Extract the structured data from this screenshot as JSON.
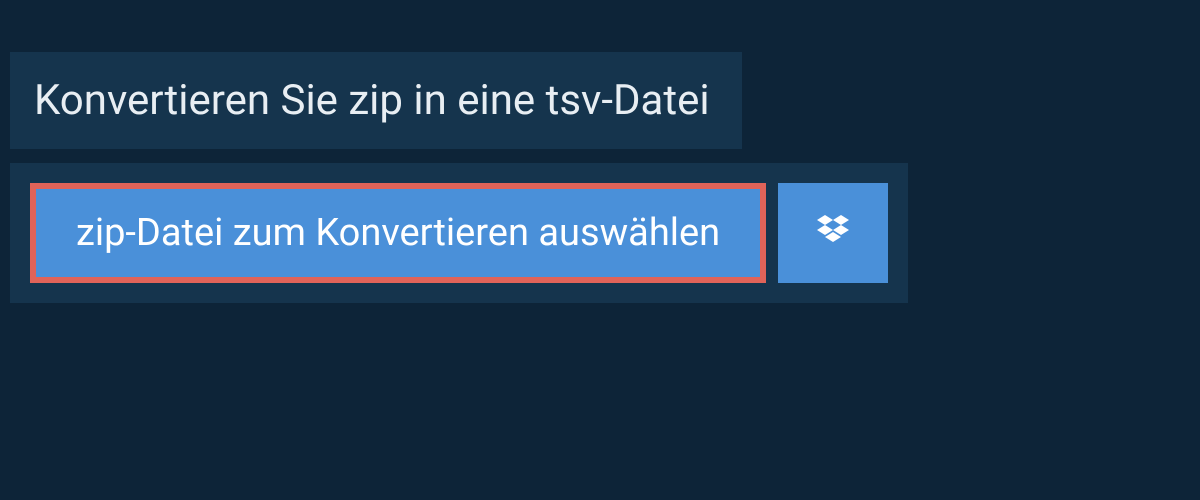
{
  "header": {
    "title": "Konvertieren Sie zip in eine tsv-Datei"
  },
  "actions": {
    "choose_file_label": "zip-Datei zum Konvertieren auswählen",
    "cloud_provider": "dropbox"
  },
  "colors": {
    "background": "#0d2438",
    "panel": "#15344d",
    "button": "#4a90d9",
    "highlight_border": "#e06359"
  }
}
